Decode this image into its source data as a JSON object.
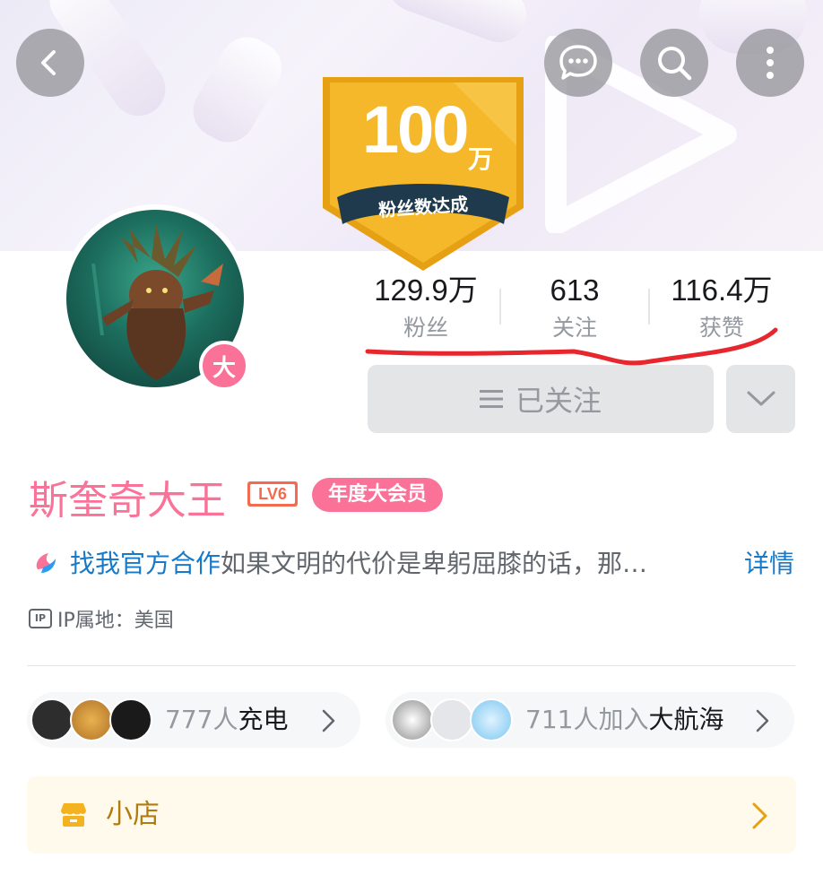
{
  "banner": {
    "milestone_number": "100",
    "milestone_unit": "万",
    "milestone_caption": "粉丝数达成"
  },
  "header": {
    "back_icon": "chevron-left-icon",
    "message_icon": "chat-bubble-icon",
    "search_icon": "search-icon",
    "more_icon": "more-vertical-icon"
  },
  "profile": {
    "avatar_badge": "大",
    "name": "斯奎奇大王",
    "level": "LV6",
    "vip_label": "年度大会员",
    "bio_link": "找我官方合作",
    "bio_text": "如果文明的代价是卑躬屈膝的话，那…",
    "bio_more": "详情",
    "ip_label": "IP属地：美国"
  },
  "stats": [
    {
      "value": "129.9万",
      "label": "粉丝"
    },
    {
      "value": "613",
      "label": "关注"
    },
    {
      "value": "116.4万",
      "label": "获赞"
    }
  ],
  "actions": {
    "follow_label": "已关注"
  },
  "charge": {
    "text_prefix": "777人",
    "text_bold": "充电"
  },
  "guard": {
    "text_prefix": "711人加入",
    "text_bold": "大航海"
  },
  "shop": {
    "label": "小店"
  },
  "colors": {
    "brand_pink": "#fb7299",
    "link_blue": "#1679c9",
    "badge_gold": "#f3b62a",
    "annotation_red": "#e8262d"
  }
}
